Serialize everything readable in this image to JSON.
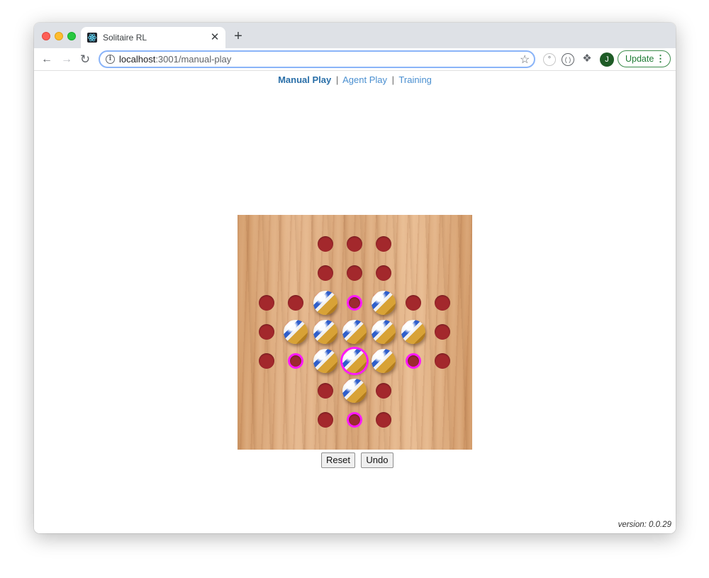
{
  "browser": {
    "tab": {
      "title": "Solitaire RL",
      "close_label": "✕"
    },
    "new_tab_label": "+",
    "url_host": "localhost",
    "url_rest": ":3001/manual-play",
    "avatar_letter": "J",
    "update_label": "Update"
  },
  "nav": {
    "links": [
      {
        "label": "Manual Play",
        "active": true
      },
      {
        "label": "Agent Play",
        "active": false
      },
      {
        "label": "Training",
        "active": false
      }
    ],
    "separator": "|"
  },
  "board": {
    "rows": 7,
    "cols": 7,
    "cells": [
      [
        null,
        null,
        "hole",
        "hole",
        "hole",
        null,
        null
      ],
      [
        null,
        null,
        "hole",
        "hole",
        "hole",
        null,
        null
      ],
      [
        "hole",
        "hole",
        "marble",
        "hole-highlight",
        "marble",
        "hole",
        "hole"
      ],
      [
        "hole",
        "marble",
        "marble",
        "marble",
        "marble",
        "marble",
        "hole"
      ],
      [
        "hole",
        "hole-highlight",
        "marble",
        "marble-selected",
        "marble",
        "hole-highlight",
        "hole"
      ],
      [
        null,
        null,
        "hole",
        "marble",
        "hole",
        null,
        null
      ],
      [
        null,
        null,
        "hole",
        "hole-highlight",
        "hole",
        null,
        null
      ]
    ],
    "colors": {
      "hole": "#a3282c",
      "highlight": "#ff19ff"
    }
  },
  "controls": {
    "reset_label": "Reset",
    "undo_label": "Undo"
  },
  "footer": {
    "version": "version: 0.0.29"
  }
}
